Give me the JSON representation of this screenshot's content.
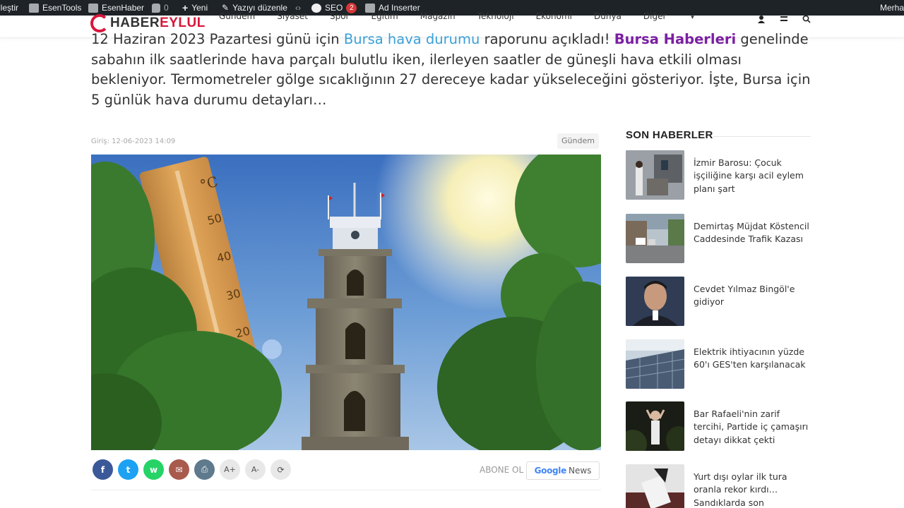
{
  "adminbar": {
    "items": [
      "lleştir",
      "EsenTools",
      "EsenHaber",
      "0",
      "Yeni",
      "Yazıyı düzenle",
      "SEO",
      "2",
      "Ad Inserter"
    ],
    "greeting": "Merha"
  },
  "header": {
    "logo_main": "HABER",
    "logo_accent": "EYLUL",
    "nav": [
      "Gündem",
      "Siyaset",
      "Spor",
      "Eğitim",
      "Magazin",
      "Teknoloji",
      "Ekonomi",
      "Dünya",
      "Diğer"
    ]
  },
  "intro": {
    "part1": "12 Haziran 2023 Pazartesi günü için ",
    "link1": "Bursa hava durumu",
    "part2": " raporunu açıkladı! ",
    "link2": "Bursa Haberleri",
    "part3": " genelinde sabahın ilk saatlerinde hava parçalı bulutlu iken, ilerleyen saatler de güneşli hava etkili olması bekleniyor. Termometreler gölge sıcaklığının 27 dereceye kadar yükseleceğini gösteriyor. İşte, Bursa için 5 günlük hava durumu detayları…"
  },
  "article": {
    "date": "Giriş: 12-06-2023 14:09",
    "category": "Gündem",
    "thermo_labels": [
      "°C",
      "50",
      "40",
      "30",
      "20"
    ]
  },
  "share": {
    "buttons": [
      "f",
      "t",
      "w",
      "✉",
      "⎙",
      "A+",
      "A-",
      "⟳"
    ],
    "abone": "ABONE OL",
    "gnews_brand": "Google",
    "gnews_label": "News"
  },
  "sidebar": {
    "title": "SON HABERLER",
    "items": [
      {
        "text": "İzmir Barosu: Çocuk işçiliğine karşı acil eylem planı şart"
      },
      {
        "text": "Demirtaş Müjdat Köstencil Caddesinde Trafik Kazası"
      },
      {
        "text": "Cevdet Yılmaz Bingöl'e gidiyor"
      },
      {
        "text": "Elektrik ihtiyacının yüzde 60'ı GES'ten karşılanacak"
      },
      {
        "text": "Bar Rafaeli'nin zarif tercihi, Partide iç çamaşırı detayı dikkat çekti"
      },
      {
        "text": "Yurt dışı oylar ilk tura oranla rekor kırdı… Sandıklarda son"
      }
    ]
  },
  "colors": {
    "adminbar": "#1d2327",
    "brand": "#d6173a",
    "link_blue": "#3aa0d8",
    "link_purple": "#7b1fa2",
    "facebook": "#3b5998",
    "twitter": "#1da1f2",
    "whatsapp": "#25d366",
    "email": "#a85a4d",
    "print": "#5e7a8c",
    "tool": "#e8e8e8"
  }
}
